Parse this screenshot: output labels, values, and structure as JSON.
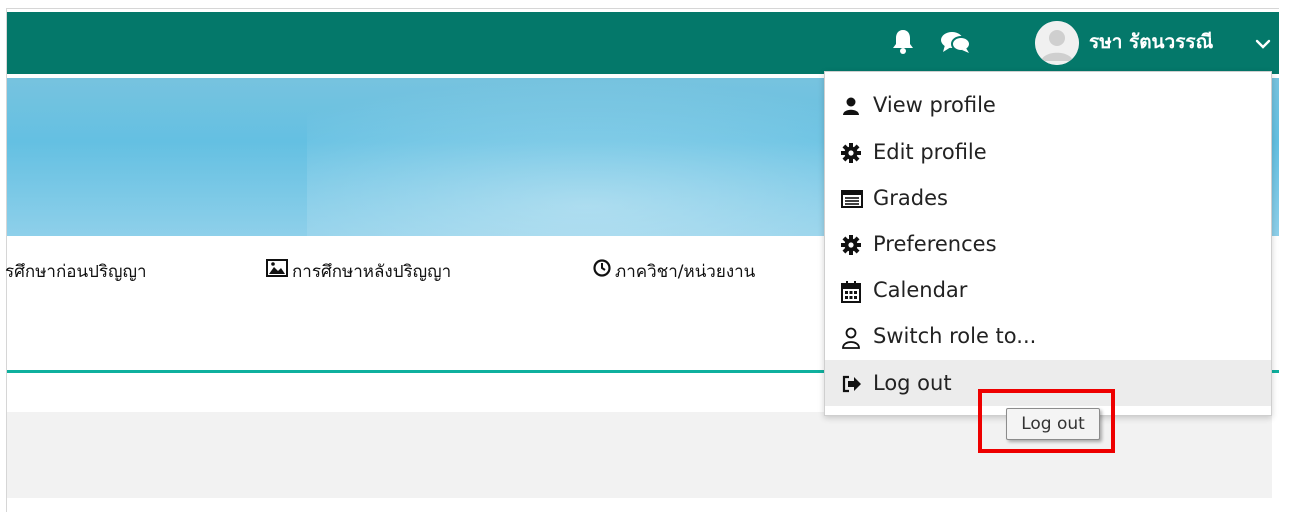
{
  "navbar": {
    "username": "รษา รัตนวรรณี",
    "icons": [
      "bell-icon",
      "chat-icon",
      "avatar",
      "chevron-down-icon"
    ],
    "color": "#04786a"
  },
  "menu": {
    "items": [
      {
        "label": "รศึกษาก่อนปริญญา"
      },
      {
        "label": "การศึกษาหลังปริญญา",
        "icon": "image-icon"
      },
      {
        "label": "ภาควิชา/หน่วยงาน",
        "icon": "clock-icon"
      }
    ]
  },
  "user_menu": {
    "items": [
      {
        "label": "View profile",
        "icon": "user-icon"
      },
      {
        "label": "Edit profile",
        "icon": "cog-icon"
      },
      {
        "label": "Grades",
        "icon": "table-icon"
      },
      {
        "label": "Preferences",
        "icon": "cog-icon"
      },
      {
        "label": "Calendar",
        "icon": "calendar-icon"
      },
      {
        "label": "Switch role to...",
        "icon": "user-outline-icon"
      },
      {
        "label": "Log out",
        "icon": "sign-out-icon"
      }
    ]
  },
  "tooltip": {
    "text": "Log out"
  },
  "colors": {
    "accent_line": "#0fb09e",
    "highlight": "#ee0000"
  }
}
